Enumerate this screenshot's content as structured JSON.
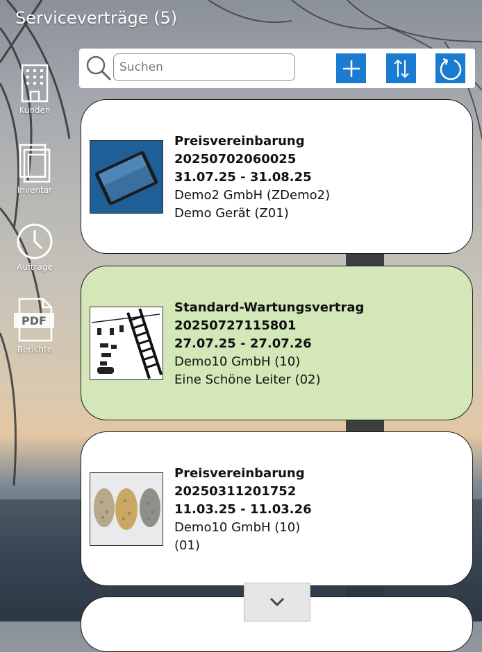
{
  "header": {
    "title": "Serviceverträge (5)"
  },
  "sidebar": {
    "items": [
      {
        "label": "Kunden",
        "icon": "building-icon"
      },
      {
        "label": "Inventar",
        "icon": "stacked-pages-icon"
      },
      {
        "label": "Aufträge",
        "icon": "clock-icon"
      },
      {
        "label": "Berichte",
        "icon": "pdf-icon"
      }
    ]
  },
  "toolbar": {
    "search_placeholder": "Suchen",
    "search_value": "",
    "add_icon": "plus-icon",
    "sort_icon": "sort-arrows-icon",
    "refresh_icon": "refresh-icon",
    "button_color": "#1b7bd0"
  },
  "contracts": [
    {
      "type": "Preisvereinbarung",
      "number": "20250702060025",
      "period": "31.07.25 - 31.08.25",
      "customer": "Demo2 GmbH (ZDemo2)",
      "device": "Demo Gerät (Z01)",
      "image": "tablet",
      "selected": false
    },
    {
      "type": "Standard-Wartungsvertrag",
      "number": "20250727115801",
      "period": "27.07.25 - 27.07.26",
      "customer": "Demo10 GmbH (10)",
      "device": "Eine Schöne Leiter (02)",
      "image": "ladder",
      "selected": true
    },
    {
      "type": "Preisvereinbarung",
      "number": "20250311201752",
      "period": "11.03.25 - 11.03.26",
      "customer": "Demo10 GmbH (10)",
      "device": "(01)",
      "image": "seeds",
      "selected": false
    }
  ],
  "colors": {
    "selected_card": "#d4e7b8",
    "card": "#ffffff"
  },
  "scroll_icon": "chevron-down-icon"
}
